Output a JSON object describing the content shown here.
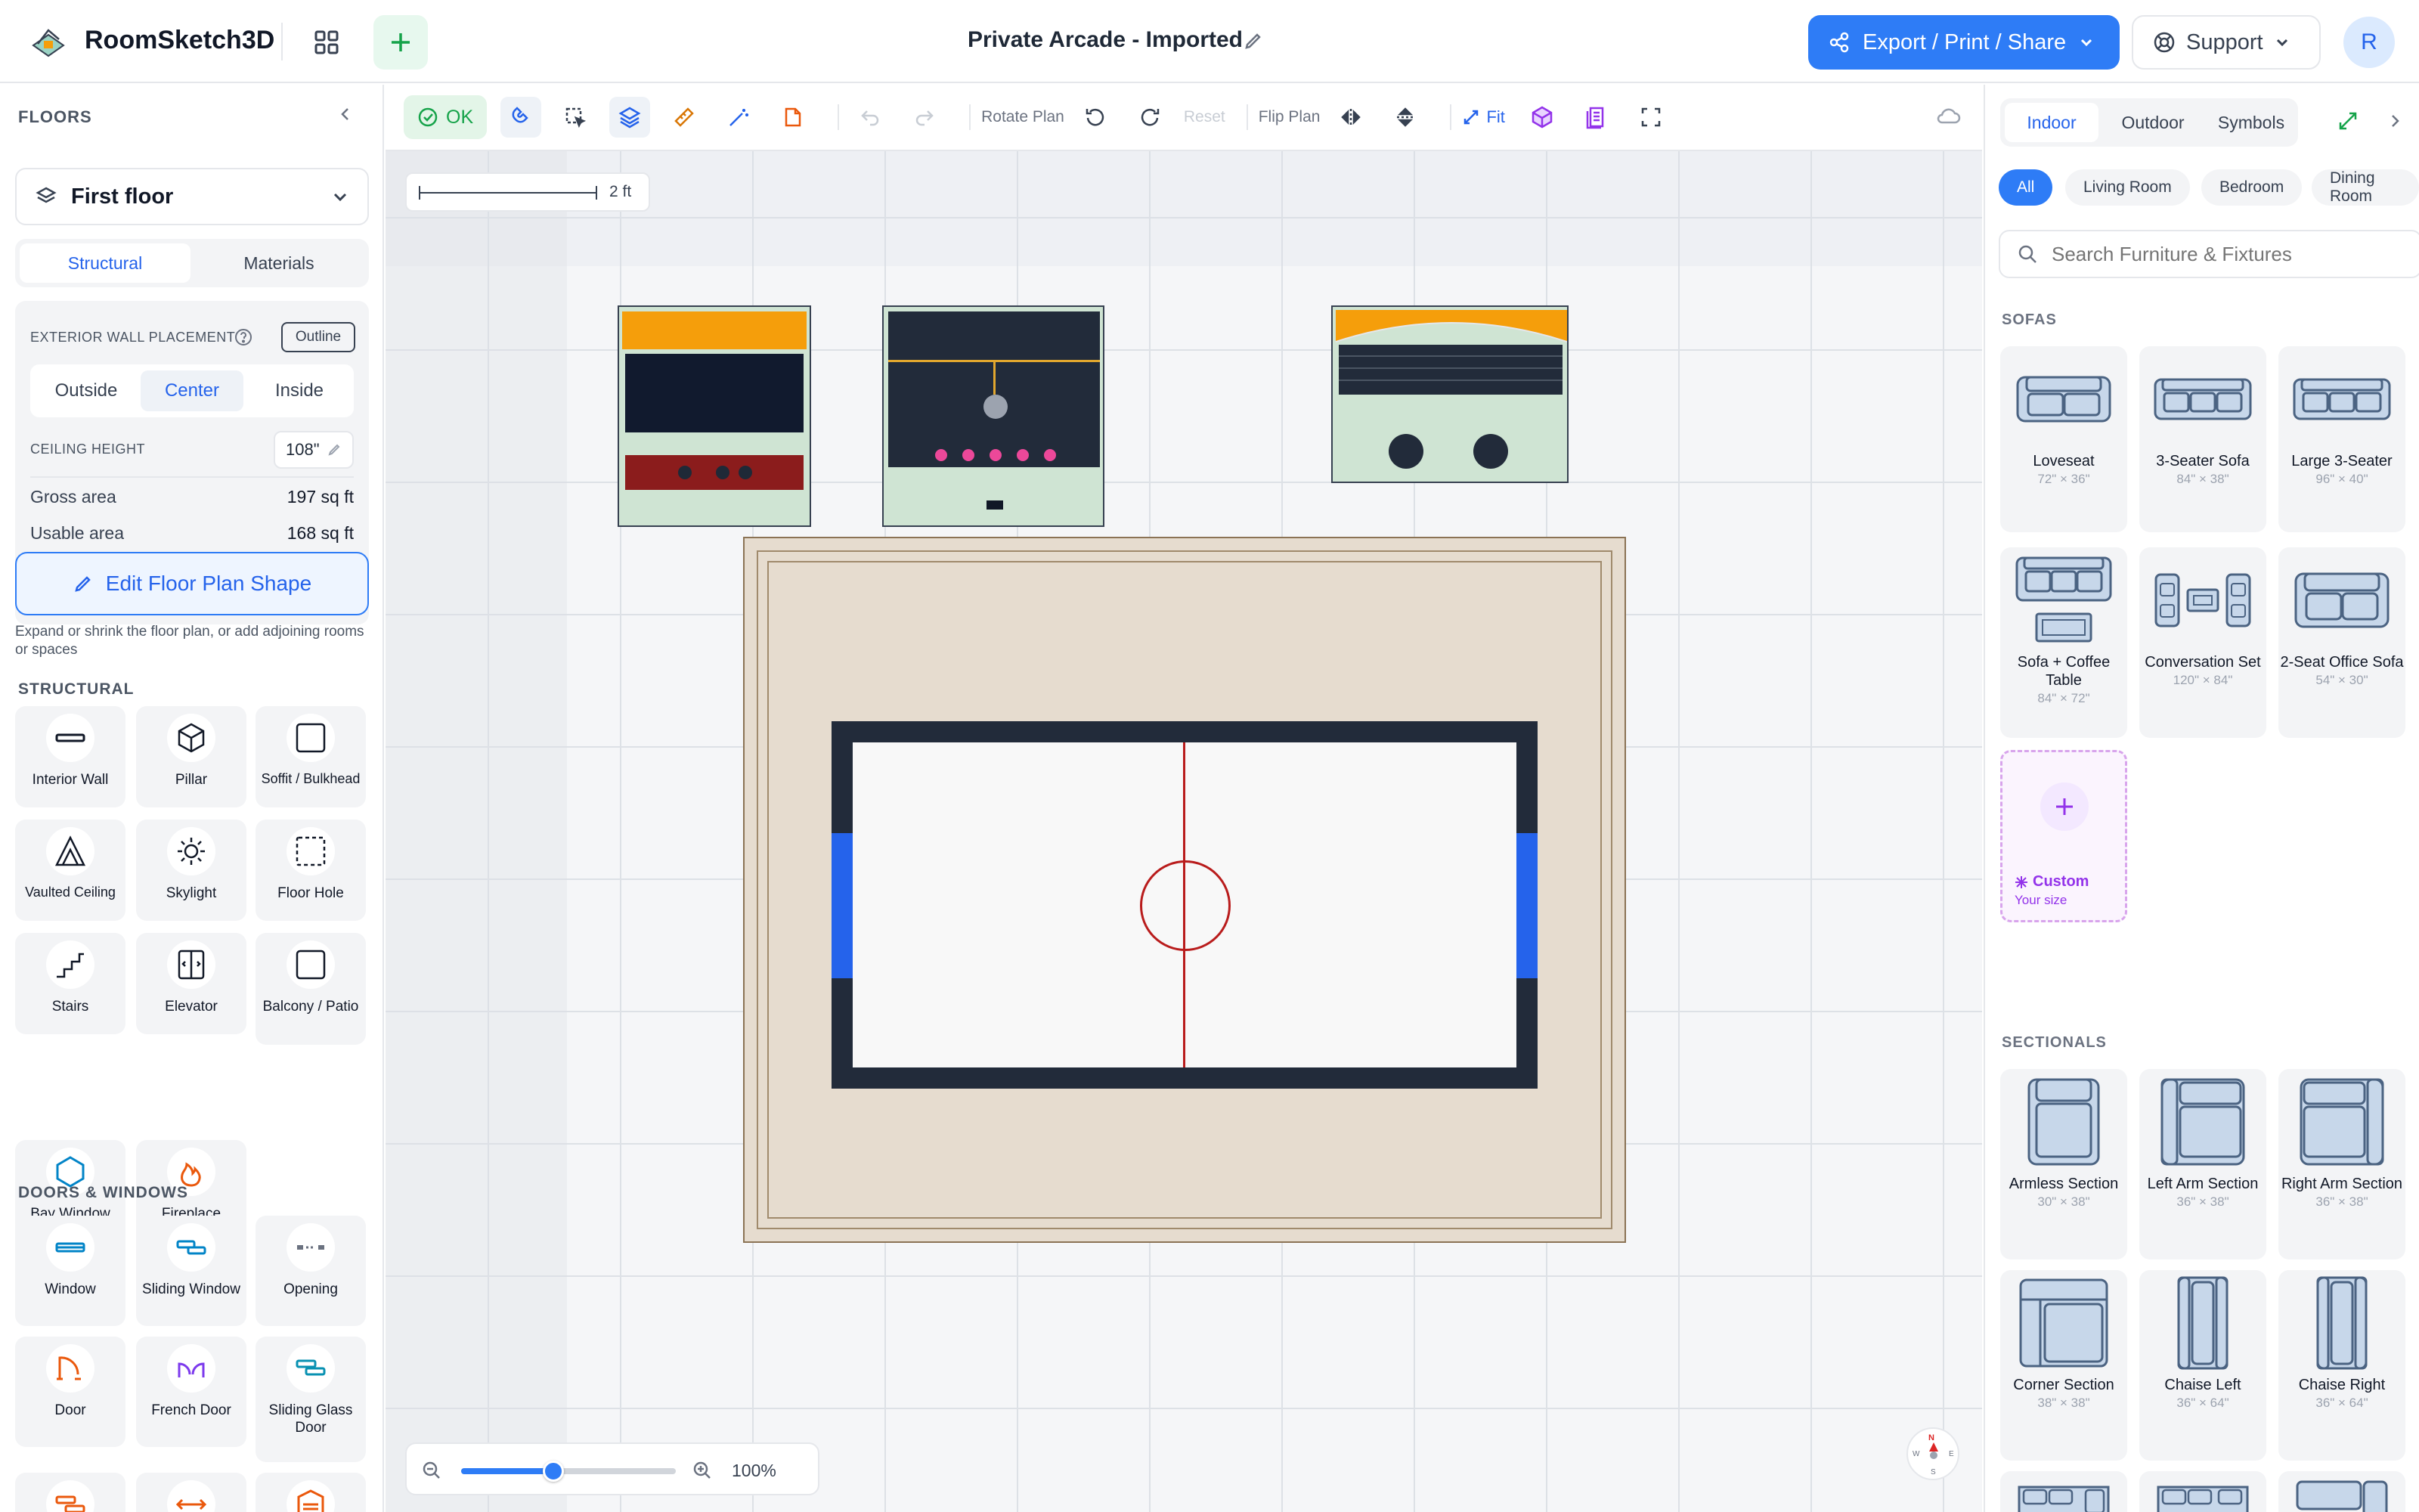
{
  "app": {
    "name": "RoomSketch3D",
    "project_title": "Private Arcade - Imported"
  },
  "header": {
    "export_label": "Export / Print / Share",
    "support_label": "Support",
    "avatar_initial": "R"
  },
  "left": {
    "floors_title": "FLOORS",
    "floor_selected": "First floor",
    "tabs": [
      "Structural",
      "Materials"
    ],
    "wall_placement_label": "EXTERIOR WALL PLACEMENT",
    "outline_label": "Outline",
    "placement_options": [
      "Outside",
      "Center",
      "Inside"
    ],
    "ceiling_label": "CEILING HEIGHT",
    "ceiling_value": "108\"",
    "gross_label": "Gross area",
    "gross_value": "197 sq ft",
    "usable_label": "Usable area",
    "usable_value": "168 sq ft",
    "edit_shape_label": "Edit Floor Plan Shape",
    "edit_shape_hint": "Expand or shrink the floor plan, or add adjoining rooms or spaces",
    "structural_title": "STRUCTURAL",
    "structural_items": [
      "Interior Wall",
      "Pillar",
      "Soffit / Bulkhead",
      "Vaulted Ceiling",
      "Skylight",
      "Floor Hole",
      "Stairs",
      "Elevator",
      "Balcony / Patio",
      "Bay Window",
      "Fireplace"
    ],
    "doors_title": "DOORS & WINDOWS",
    "door_items": [
      "Window",
      "Sliding Window",
      "Opening",
      "Door",
      "French Door",
      "Sliding Glass Door"
    ]
  },
  "toolbar": {
    "ok_label": "OK",
    "rotate_label": "Rotate Plan",
    "reset_label": "Reset",
    "flip_label": "Flip Plan",
    "fit_label": "Fit"
  },
  "canvas": {
    "scale_label": "2 ft",
    "zoom_percent": 100,
    "zoom_label": "100%",
    "compass": {
      "n": "N",
      "e": "E",
      "s": "S",
      "w": "W"
    }
  },
  "right": {
    "tabs": [
      "Indoor",
      "Outdoor",
      "Symbols"
    ],
    "filters": [
      "All",
      "Living Room",
      "Bedroom",
      "Dining Room"
    ],
    "search_placeholder": "Search Furniture & Fixtures",
    "sofas_title": "SOFAS",
    "sofas": [
      {
        "name": "Loveseat",
        "dim": "72\" × 36\""
      },
      {
        "name": "3-Seater Sofa",
        "dim": "84\" × 38\""
      },
      {
        "name": "Large 3-Seater",
        "dim": "96\" × 40\""
      },
      {
        "name": "Sofa + Coffee Table",
        "dim": "84\" × 72\""
      },
      {
        "name": "Conversation Set",
        "dim": "120\" × 84\""
      },
      {
        "name": "2-Seat Office Sofa",
        "dim": "54\" × 30\""
      }
    ],
    "custom_label": "Custom",
    "custom_hint": "Your size",
    "sectionals_title": "SECTIONALS",
    "sectionals": [
      {
        "name": "Armless Section",
        "dim": "30\" × 38\""
      },
      {
        "name": "Left Arm Section",
        "dim": "36\" × 38\""
      },
      {
        "name": "Right Arm Section",
        "dim": "36\" × 38\""
      },
      {
        "name": "Corner Section",
        "dim": "38\" × 38\""
      },
      {
        "name": "Chaise Left",
        "dim": "36\" × 64\""
      },
      {
        "name": "Chaise Right",
        "dim": "36\" × 64\""
      }
    ]
  },
  "colors": {
    "accent": "#2e7cf6",
    "ok_green": "#16a34a",
    "custom_purple": "#9333ea"
  }
}
